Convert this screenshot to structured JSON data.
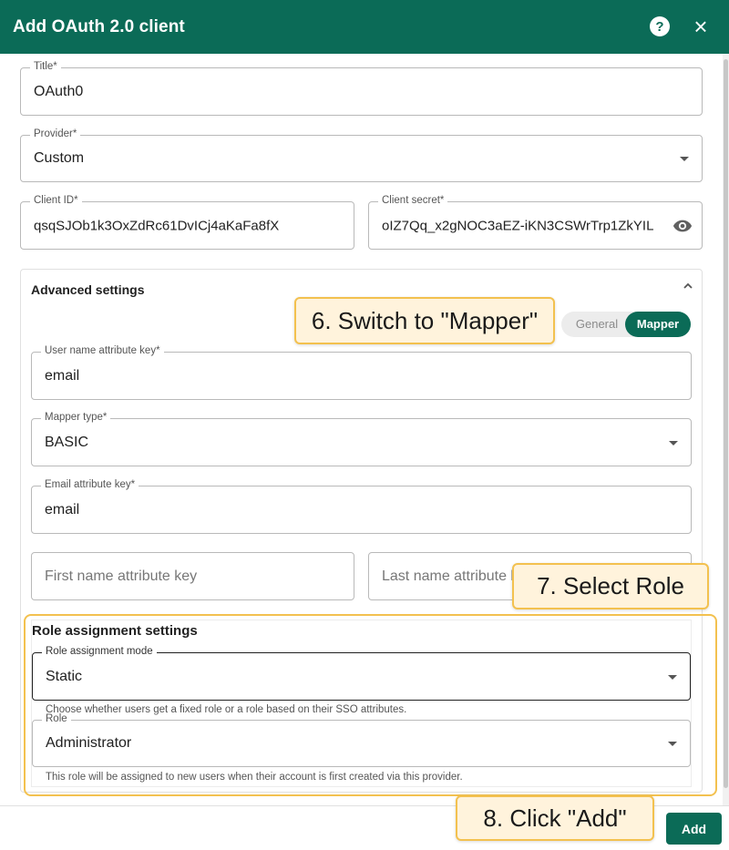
{
  "dialog": {
    "title": "Add OAuth 2.0 client",
    "help_icon": "help-circle-icon",
    "close_icon": "close-icon",
    "close_glyph": "×",
    "help_glyph": "?"
  },
  "form": {
    "title": {
      "label": "Title*",
      "value": "OAuth0"
    },
    "provider": {
      "label": "Provider*",
      "value": "Custom"
    },
    "client_id": {
      "label": "Client ID*",
      "value": "qsqSJOb1k3OxZdRc61DvICj4aKaFa8fX"
    },
    "client_secret": {
      "label": "Client secret*",
      "value": "oIZ7Qq_x2gNOC3aEZ-iKN3CSWrTrp1ZkYIL"
    }
  },
  "advanced": {
    "title": "Advanced settings",
    "toggle": {
      "options": [
        "General",
        "Mapper"
      ],
      "selected": "Mapper"
    },
    "user_name_key": {
      "label": "User name attribute key*",
      "value": "email"
    },
    "mapper_type": {
      "label": "Mapper type*",
      "value": "BASIC"
    },
    "email_key": {
      "label": "Email attribute key*",
      "value": "email"
    },
    "first_name_key": {
      "placeholder": "First name attribute key"
    },
    "last_name_key": {
      "placeholder": "Last name attribute key"
    }
  },
  "role_settings": {
    "title": "Role assignment settings",
    "mode": {
      "label": "Role assignment mode",
      "value": "Static",
      "helper": "Choose whether users get a fixed role or a role based on their SSO attributes."
    },
    "role": {
      "label": "Role",
      "value": "Administrator",
      "helper": "This role will be assigned to new users when their account is first created via this provider."
    }
  },
  "footer": {
    "add_label": "Add"
  },
  "annotations": {
    "step6": "6. Switch to \"Mapper\"",
    "step7": "7. Select Role",
    "step8": "8. Click \"Add\""
  },
  "colors": {
    "brand": "#0b6b57",
    "callout_bg": "#fff3dc",
    "callout_border": "#f3c14f"
  }
}
